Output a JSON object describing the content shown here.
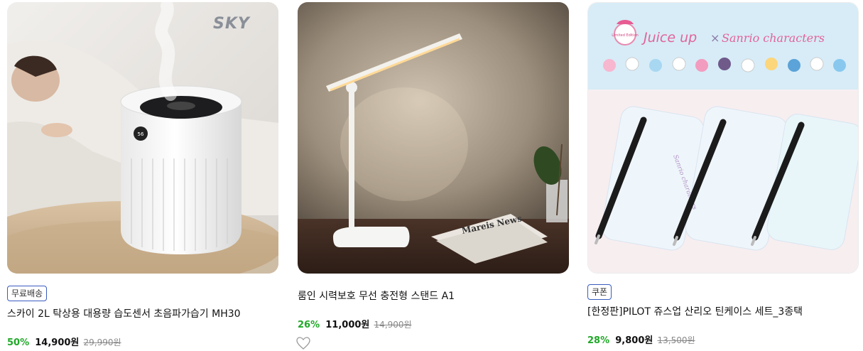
{
  "products": [
    {
      "brand_logo": "SKY",
      "badge": "무료배송",
      "title": "스카이 2L 탁상용 대용량 습도센서 초음파가습기 MH30",
      "discount": "50%",
      "price": "14,900원",
      "original_price": "29,990원"
    },
    {
      "title": "룸인 시력보호 무선 충전형 스탠드 A1",
      "discount": "26%",
      "price": "11,000원",
      "original_price": "14,900원",
      "newspaper_text": "Mareis News"
    },
    {
      "badge": "쿠폰",
      "title": "[한정판]PILOT 쥬스업 산리오 틴케이스 세트_3종택",
      "discount": "28%",
      "price": "9,800원",
      "original_price": "13,500원",
      "banner_left": "Juice up",
      "banner_x": "×",
      "banner_right": "Sanrio characters",
      "case_text": "Sanrio characters",
      "seal_text": "Limited Edition"
    }
  ],
  "icons": {
    "wishlist": "heart-outline-icon"
  },
  "colors": {
    "discount": "#21a829",
    "badge_border": "#3a5bbf"
  }
}
